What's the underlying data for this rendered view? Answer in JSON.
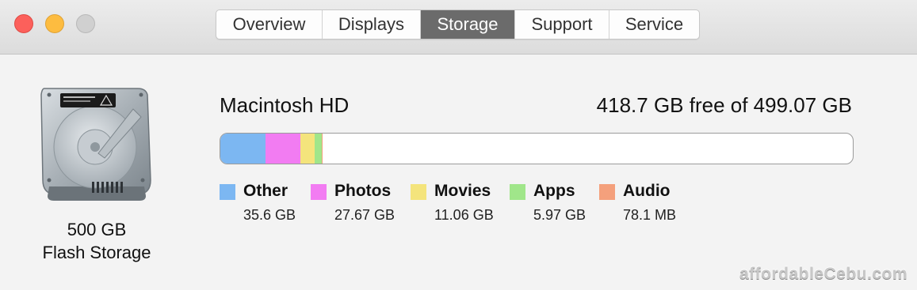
{
  "window": {
    "tabs": [
      {
        "label": "Overview"
      },
      {
        "label": "Displays"
      },
      {
        "label": "Storage",
        "active": true
      },
      {
        "label": "Support"
      },
      {
        "label": "Service"
      }
    ]
  },
  "disk": {
    "icon": "hard-drive-icon",
    "capacity": "500 GB",
    "type": "Flash Storage"
  },
  "volume": {
    "name": "Macintosh HD",
    "free_text": "418.7 GB free of 499.07 GB",
    "total_gb": 499.07,
    "categories": [
      {
        "label": "Other",
        "size_text": "35.6 GB",
        "gb": 35.6,
        "color": "#7cb7f2"
      },
      {
        "label": "Photos",
        "size_text": "27.67 GB",
        "gb": 27.67,
        "color": "#f27cf2"
      },
      {
        "label": "Movies",
        "size_text": "11.06 GB",
        "gb": 11.06,
        "color": "#f4e47c"
      },
      {
        "label": "Apps",
        "size_text": "5.97 GB",
        "gb": 5.97,
        "color": "#a0e68a"
      },
      {
        "label": "Audio",
        "size_text": "78.1 MB",
        "gb": 0.0781,
        "color": "#f4a07c"
      }
    ]
  },
  "watermark": "affordableCebu.com"
}
